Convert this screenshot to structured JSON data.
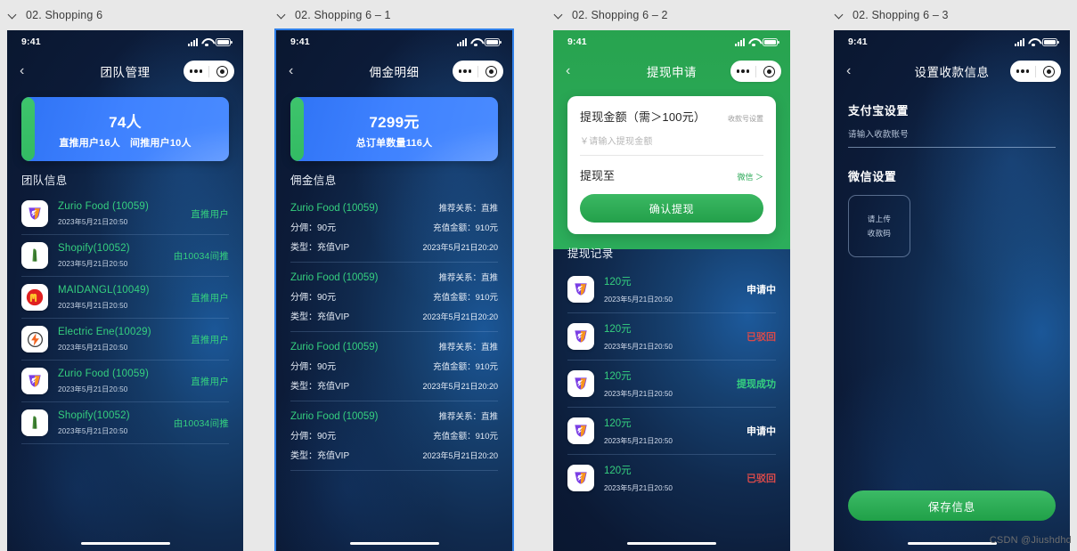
{
  "canvas": {
    "watermark": "CSDN @Jiushdhd",
    "bg": "#e8e8e8"
  },
  "colors": {
    "navy": "#0c1b38",
    "blue_accent": "#3f82ff",
    "green": "#35d07f",
    "wechat_green": "#2aa856",
    "red": "#d94a4a",
    "white": "#ffffff"
  },
  "artboards": [
    {
      "label": "02. Shopping 6",
      "selected": false
    },
    {
      "label": "02. Shopping 6 – 1",
      "selected": true
    },
    {
      "label": "02. Shopping 6 – 2",
      "selected": false
    },
    {
      "label": "02. Shopping 6 – 3",
      "selected": false
    }
  ],
  "status_bar": {
    "time": "9:41",
    "signal": "signal-icon",
    "wifi": "wifi-icon",
    "battery": "battery-icon"
  },
  "screen1": {
    "nav": {
      "back": "‹",
      "title": "团队管理"
    },
    "hero": {
      "amount": "74人",
      "sub_a_label": "直推用户",
      "sub_a_value": "16人",
      "sub_b_label": "间推用户",
      "sub_b_value": "10人"
    },
    "section_title": "团队信息",
    "rows": [
      {
        "icon": "zurio-food-icon",
        "name": "Zurio Food (10059)",
        "date": "2023年5月21日20:50",
        "tag": "直推用户"
      },
      {
        "icon": "shopify-icon",
        "name": "Shopify(10052)",
        "date": "2023年5月21日20:50",
        "tag": "由10034间推"
      },
      {
        "icon": "maidangl-icon",
        "name": "MAIDANGL(10049)",
        "date": "2023年5月21日20:50",
        "tag": "直推用户"
      },
      {
        "icon": "electric-ene-icon",
        "name": "Electric Ene(10029)",
        "date": "2023年5月21日20:50",
        "tag": "直推用户"
      },
      {
        "icon": "zurio-food-icon",
        "name": "Zurio Food (10059)",
        "date": "2023年5月21日20:50",
        "tag": "直推用户"
      },
      {
        "icon": "shopify-icon",
        "name": "Shopify(10052)",
        "date": "2023年5月21日20:50",
        "tag": "由10034间推"
      }
    ]
  },
  "screen2": {
    "nav": {
      "back": "‹",
      "title": "佣金明细"
    },
    "hero": {
      "amount": "7299元",
      "sub_label": "总订单数量",
      "sub_value": "116人"
    },
    "section_title": "佣金信息",
    "rows": [
      {
        "name": "Zurio Food (10059)",
        "relation": "推荐关系：直推",
        "commission": "分佣：90元",
        "recharge": "充值金额：910元",
        "type": "类型：充值VIP",
        "date": "2023年5月21日20:20"
      },
      {
        "name": "Zurio Food (10059)",
        "relation": "推荐关系：直推",
        "commission": "分佣：90元",
        "recharge": "充值金额：910元",
        "type": "类型：充值VIP",
        "date": "2023年5月21日20:20"
      },
      {
        "name": "Zurio Food (10059)",
        "relation": "推荐关系：直推",
        "commission": "分佣：90元",
        "recharge": "充值金额：910元",
        "type": "类型：充值VIP",
        "date": "2023年5月21日20:20"
      },
      {
        "name": "Zurio Food (10059)",
        "relation": "推荐关系：直推",
        "commission": "分佣：90元",
        "recharge": "充值金额：910元",
        "type": "类型：充值VIP",
        "date": "2023年5月21日20:20"
      }
    ]
  },
  "screen3": {
    "nav": {
      "back": "‹",
      "title": "提现申请"
    },
    "card": {
      "title": "提现金额（需＞100元）",
      "account_link": "收款号设置",
      "amount_placeholder": "￥请输入提现金额",
      "withdraw_to_label": "提现至",
      "withdraw_to_value": "微信 ＞",
      "confirm_button": "确认提现"
    },
    "section_title": "提现记录",
    "records": [
      {
        "icon": "zurio-food-icon",
        "amount": "120元",
        "date": "2023年5月21日20:50",
        "status": "申请中",
        "status_color": "#ffffff"
      },
      {
        "icon": "zurio-food-icon",
        "amount": "120元",
        "date": "2023年5月21日20:50",
        "status": "已驳回",
        "status_color": "#d94a4a"
      },
      {
        "icon": "zurio-food-icon",
        "amount": "120元",
        "date": "2023年5月21日20:50",
        "status": "提现成功",
        "status_color": "#35d07f"
      },
      {
        "icon": "zurio-food-icon",
        "amount": "120元",
        "date": "2023年5月21日20:50",
        "status": "申请中",
        "status_color": "#ffffff"
      },
      {
        "icon": "zurio-food-icon",
        "amount": "120元",
        "date": "2023年5月21日20:50",
        "status": "已驳回",
        "status_color": "#d94a4a"
      }
    ]
  },
  "screen4": {
    "nav": {
      "back": "‹",
      "title": "设置收款信息"
    },
    "alipay_label": "支付宝设置",
    "alipay_placeholder": "请输入收款账号",
    "wechat_label": "微信设置",
    "upload_line1": "请上传",
    "upload_line2": "收款码",
    "save_button": "保存信息"
  }
}
